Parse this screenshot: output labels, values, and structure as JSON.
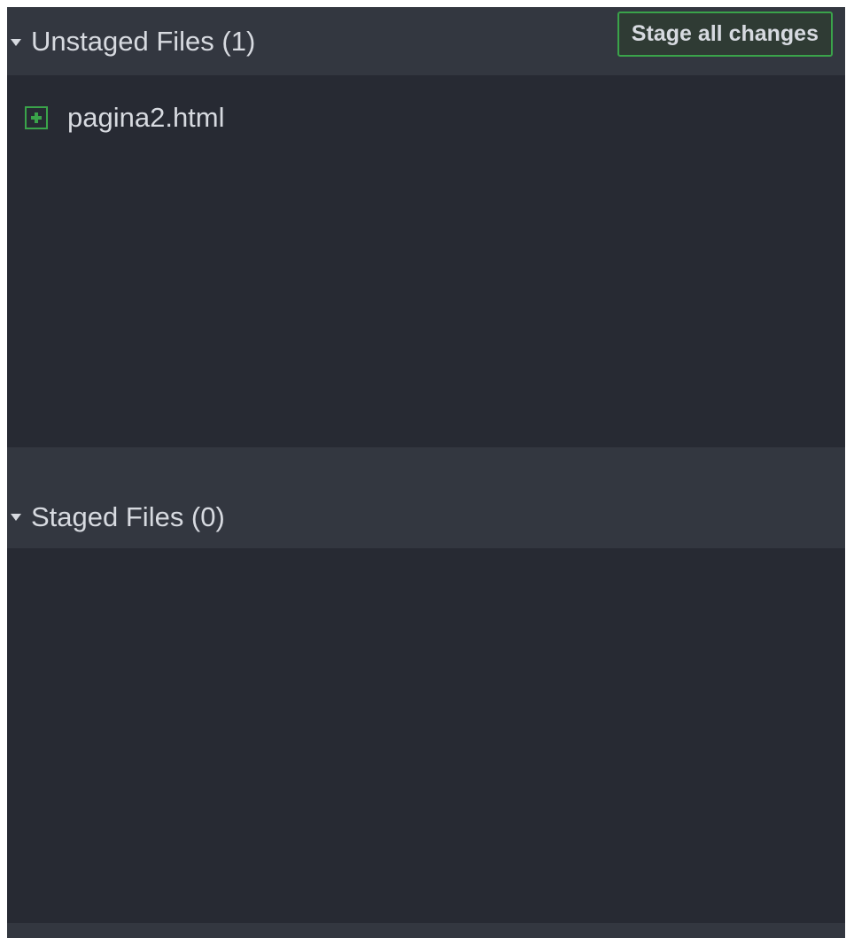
{
  "unstaged": {
    "title": "Unstaged Files (1)",
    "stage_all_label": "Stage all changes",
    "files": [
      {
        "name": "pagina2.html",
        "status_icon": "file-added-icon"
      }
    ]
  },
  "staged": {
    "title": "Staged Files (0)",
    "files": []
  },
  "colors": {
    "panel_bg": "#333740",
    "list_bg": "#272a33",
    "accent_green": "#3aa34a",
    "text": "#d7dae0"
  }
}
